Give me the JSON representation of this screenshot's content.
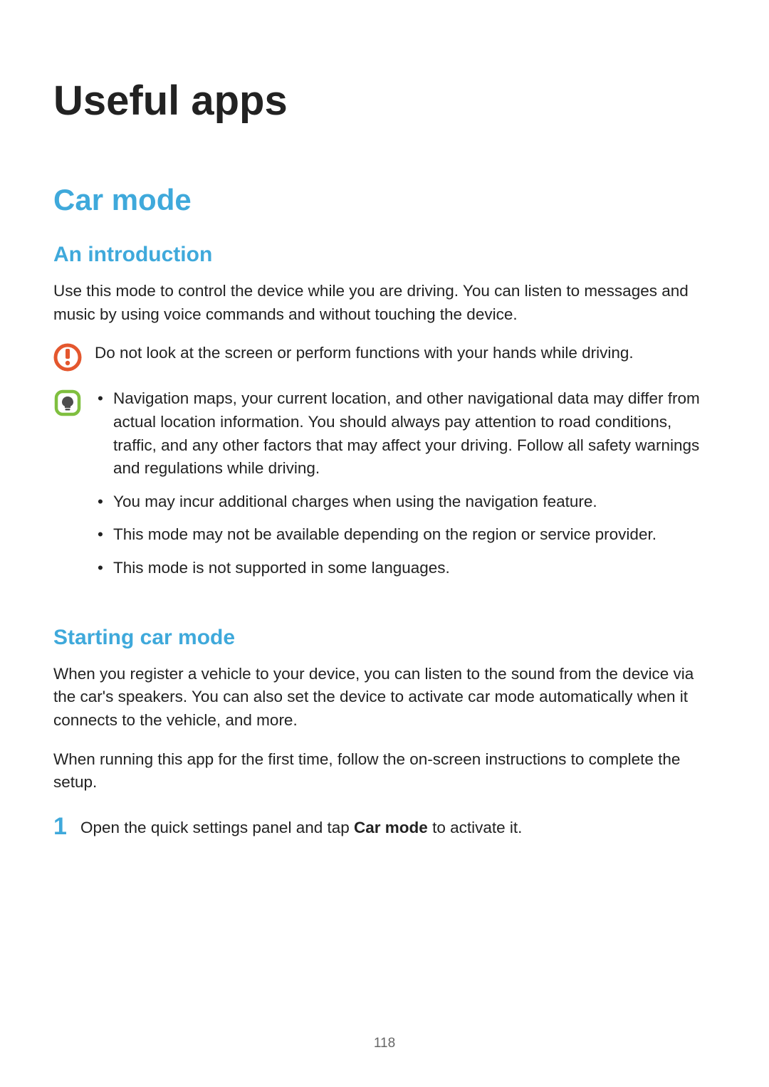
{
  "page": {
    "title": "Useful apps",
    "number": "118"
  },
  "section1": {
    "heading": "Car mode",
    "subsection1": {
      "heading": "An introduction",
      "paragraph1": "Use this mode to control the device while you are driving. You can listen to messages and music by using voice commands and without touching the device.",
      "warning": "Do not look at the screen or perform functions with your hands while driving.",
      "notes": {
        "item1": "Navigation maps, your current location, and other navigational data may differ from actual location information. You should always pay attention to road conditions, traffic, and any other factors that may affect your driving. Follow all safety warnings and regulations while driving.",
        "item2": "You may incur additional charges when using the navigation feature.",
        "item3": "This mode may not be available depending on the region or service provider.",
        "item4": "This mode is not supported in some languages."
      }
    },
    "subsection2": {
      "heading": "Starting car mode",
      "paragraph1": "When you register a vehicle to your device, you can listen to the sound from the device via the car's speakers. You can also set the device to activate car mode automatically when it connects to the vehicle, and more.",
      "paragraph2": "When running this app for the first time, follow the on-screen instructions to complete the setup.",
      "step1": {
        "number": "1",
        "text_before": "Open the quick settings panel and tap ",
        "text_bold": "Car mode",
        "text_after": " to activate it."
      }
    }
  }
}
